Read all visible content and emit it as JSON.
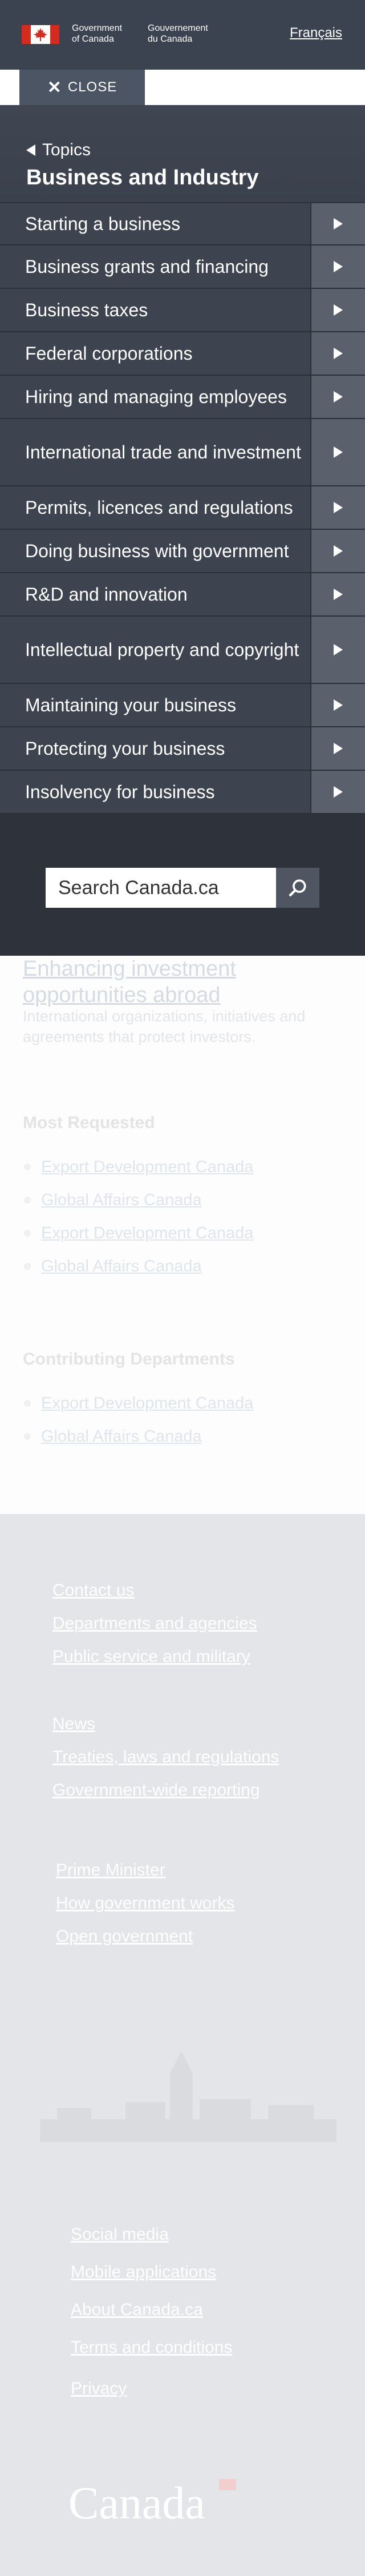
{
  "header": {
    "gov_en_line1": "Government",
    "gov_en_line2": "of Canada",
    "gov_fr_line1": "Gouvernement",
    "gov_fr_line2": "du Canada",
    "language_link": "Français",
    "close_label": "CLOSE",
    "search_label": "SEARCH"
  },
  "menu": {
    "back_label": "Topics",
    "title": "Business and Industry",
    "items": [
      {
        "label": "Starting a business"
      },
      {
        "label": "Business grants and financing"
      },
      {
        "label": "Business taxes"
      },
      {
        "label": "Federal corporations"
      },
      {
        "label": "Hiring and managing employees"
      },
      {
        "label": "International trade and investment"
      },
      {
        "label": "Permits, licences and regulations"
      },
      {
        "label": "Doing business with government"
      },
      {
        "label": "R&D and innovation"
      },
      {
        "label": "Intellectual property and copyright"
      },
      {
        "label": "Maintaining your business"
      },
      {
        "label": "Protecting your business"
      },
      {
        "label": "Insolvency for business"
      }
    ],
    "search_placeholder": "Search Canada.ca"
  },
  "content": {
    "link_title": "Enhancing investment opportunities abroad",
    "description": "International organizations, initiatives and agreements that protect investors.",
    "most_requested_heading": "Most Requested",
    "most_requested": [
      "Export Development Canada",
      "Global Affairs Canada",
      "Export Development Canada",
      "Global Affairs Canada"
    ],
    "contributing_heading": "Contributing Departments",
    "contributing": [
      "Export Development Canada",
      "Global Affairs Canada"
    ]
  },
  "footer": {
    "group1": [
      "Contact us",
      "Departments and agencies",
      "Public service and military"
    ],
    "group2": [
      "News",
      "Treaties, laws and regulations",
      "Government-wide reporting"
    ],
    "group3": [
      "Prime Minister",
      "How government works",
      "Open government"
    ],
    "bottom_links": [
      "Social media",
      "Mobile applications",
      "About Canada.ca",
      "Terms and conditions",
      "Privacy"
    ],
    "wordmark": "Canada"
  },
  "colors": {
    "header_bg": "#3b4350",
    "menu_item_bg": "#3d4450",
    "arrow_box_bg": "#5a616d",
    "flag_red": "#d52b1e",
    "footer_bg": "#e4e5e8"
  }
}
